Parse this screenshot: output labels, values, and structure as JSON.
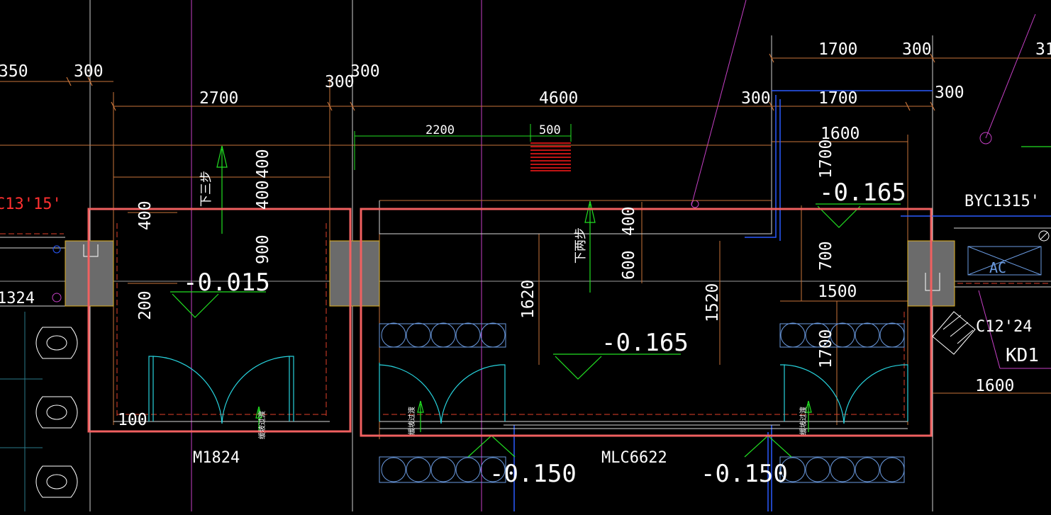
{
  "colors": {
    "background": "#000000",
    "dimension_line": "#c8743a",
    "dimension_text": "#ffffff",
    "highlight_box": "#f06060",
    "wall_fill": "#6b6b6b",
    "door_swing": "#27d3dd",
    "arrow_green": "#22e022",
    "axis_magenta": "#c640c6",
    "stair_red": "#ff1a1a",
    "blue_line": "#2a5aff",
    "label_red": "#ff3030"
  },
  "dimensions": {
    "d_350": "350",
    "d_300_left": "300",
    "d_2700": "2700",
    "d_300_a": "300",
    "d_300_b": "300",
    "d_4600": "4600",
    "d_2200": "2200",
    "d_500": "500",
    "d_1700_top": "1700",
    "d_300_top_right": "300",
    "d_31": "31",
    "d_300_c": "300",
    "d_1700_mid": "1700",
    "d_300_d": "300",
    "d_1600_top": "1600",
    "d_400_a": "400",
    "d_400_b": "400",
    "d_400_c": "400",
    "d_900": "900",
    "d_200": "200",
    "d_100": "100",
    "d_1620": "1620",
    "d_600": "600",
    "d_400_d": "400",
    "d_1520": "1520",
    "d_1700_v": "1700",
    "d_700": "700",
    "d_1500": "1500",
    "d_1700_v2": "1700",
    "d_1600_bottom": "1600"
  },
  "elevations": {
    "e_left": "-0.015",
    "e_center": "-0.165",
    "e_top_right": "-0.165",
    "e_bottom_center": "-0.150",
    "e_bottom_right": "-0.150"
  },
  "labels": {
    "c13_15": "C13'15'",
    "m1324": "1324",
    "m1824": "M1824",
    "mlc6622": "MLC6622",
    "byc1315": "BYC1315'",
    "c12_24": "C12'24",
    "kd1": "KD1",
    "ac": "AC",
    "down_three_steps": "下三步",
    "down_two_steps": "下两步",
    "slope_left": "缓坡过渡",
    "slope_center": "缓坡过渡",
    "slope_right": "缓坡过渡"
  }
}
